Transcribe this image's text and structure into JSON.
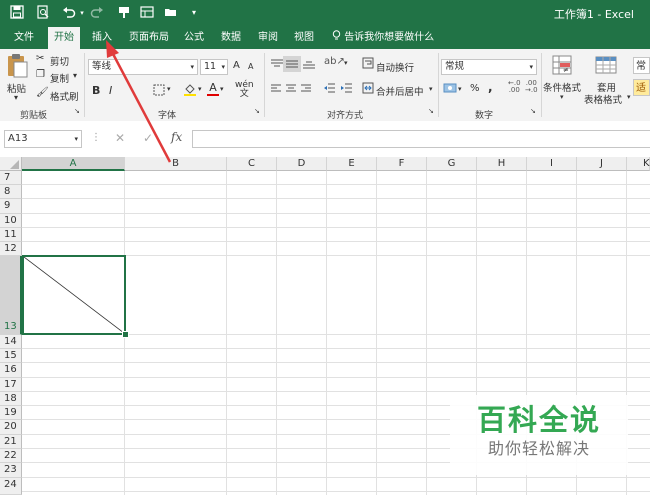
{
  "window": {
    "title": "工作簿1 - Excel"
  },
  "quick_access": {
    "icons": [
      "save-icon",
      "print-preview-icon",
      "undo-icon",
      "redo-icon",
      "format-painter-icon",
      "form-icon",
      "open-icon",
      "customize-icon"
    ]
  },
  "menu": {
    "items": [
      "文件",
      "开始",
      "插入",
      "页面布局",
      "公式",
      "数据",
      "审阅",
      "视图"
    ],
    "active": "开始",
    "tell_me": "告诉我你想要做什么"
  },
  "ribbon": {
    "clipboard": {
      "paste": "粘贴",
      "cut": "剪切",
      "copy": "复制",
      "format_painter": "格式刷",
      "label": "剪贴板"
    },
    "font": {
      "name": "等线",
      "size": "11",
      "bold": "B",
      "italic": "I",
      "label": "字体",
      "grow": "A",
      "shrink": "A"
    },
    "alignment": {
      "wrap": "自动换行",
      "merge": "合并后居中",
      "label": "对齐方式"
    },
    "number": {
      "format": "常规",
      "label": "数字",
      "percent": "%",
      "comma": ","
    },
    "styles": {
      "conditional": "条件格式",
      "table_format": "套用",
      "table_format2": "表格格式",
      "cell_style": "常",
      "cell_style2": "适"
    }
  },
  "formula_bar": {
    "name_box": "A13",
    "fx": "fx",
    "cancel": "✕",
    "enter": "✓"
  },
  "grid": {
    "columns": [
      "A",
      "B",
      "C",
      "D",
      "E",
      "F",
      "G",
      "H",
      "I",
      "J",
      "K"
    ],
    "selected_column": "A",
    "rows": [
      "7",
      "8",
      "9",
      "10",
      "11",
      "12",
      "13",
      "14",
      "15",
      "16",
      "17",
      "18",
      "19",
      "20",
      "21",
      "22",
      "23",
      "24"
    ],
    "selected_row": "13",
    "active_cell": "A13"
  },
  "watermark": {
    "title": "百科全说",
    "subtitle": "助你轻松解决"
  },
  "colors": {
    "excel_green": "#217346",
    "arrow_red": "#e03b3b",
    "watermark_green": "#34a853"
  }
}
